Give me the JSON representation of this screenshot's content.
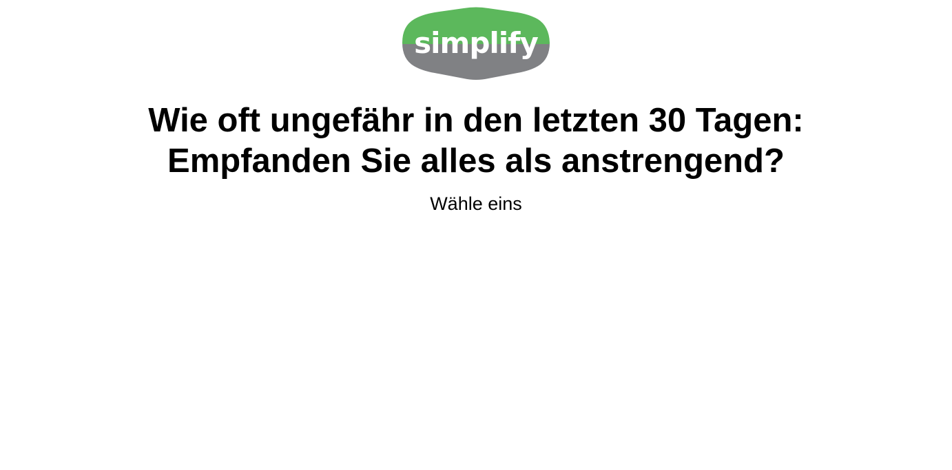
{
  "logo": {
    "text": "simplify",
    "color_top": "#5cb85c",
    "color_bottom": "#808184",
    "text_color": "#ffffff"
  },
  "question": {
    "line1": "Wie oft ungefähr in den letzten 30 Tagen:",
    "line2": "Empfanden Sie alles als anstrengend?"
  },
  "instruction": "Wähle eins"
}
